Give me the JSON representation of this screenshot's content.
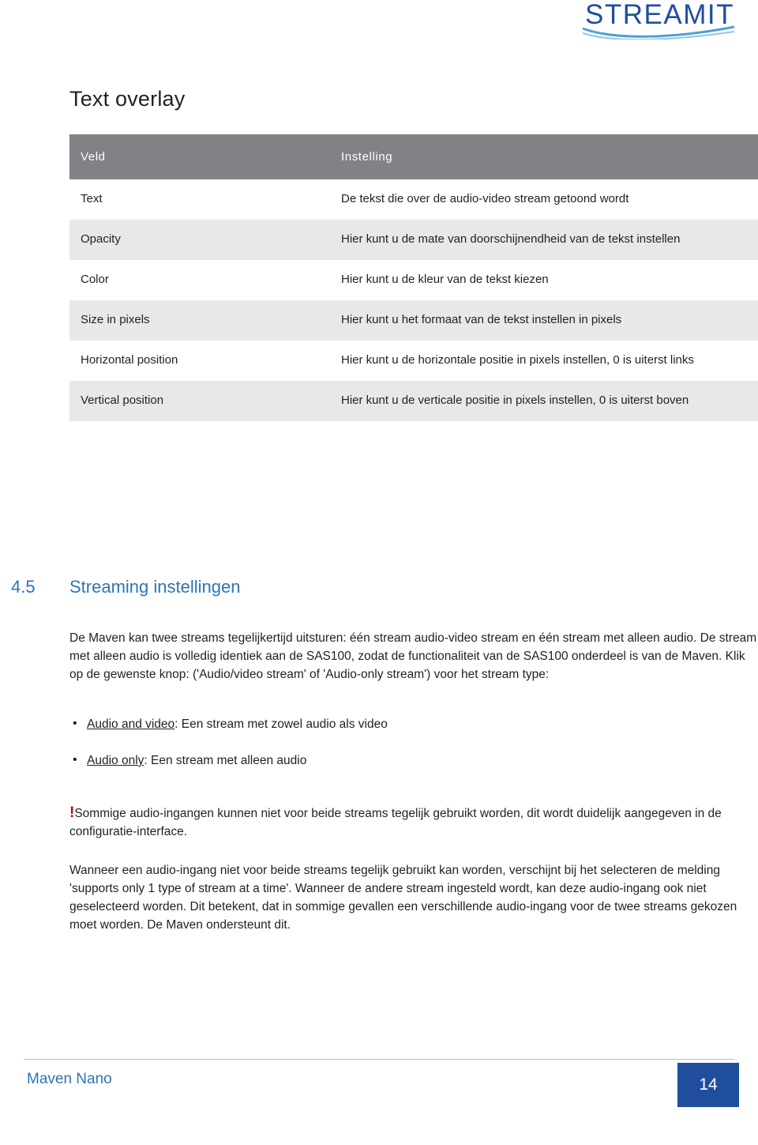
{
  "logo": {
    "text": "STREAMIT",
    "color": "#1f4e9c"
  },
  "page_title": "Text overlay",
  "table": {
    "headers": [
      "Veld",
      "Instelling"
    ],
    "rows": [
      {
        "field": "Text",
        "setting": "De tekst die over de audio-video stream getoond wordt"
      },
      {
        "field": "Opacity",
        "setting": "Hier kunt u de mate van doorschijnendheid van de tekst instellen"
      },
      {
        "field": "Color",
        "setting": "Hier kunt u de kleur van de tekst kiezen"
      },
      {
        "field": "Size in pixels",
        "setting": "Hier kunt u het formaat van de tekst instellen in pixels"
      },
      {
        "field": "Horizontal position",
        "setting": "Hier kunt u de horizontale positie in pixels instellen, 0 is uiterst links"
      },
      {
        "field": "Vertical position",
        "setting": "Hier kunt u de verticale positie in pixels instellen, 0 is uiterst boven"
      }
    ],
    "header_bg": "#808285",
    "row_alt_bg": "#e7e8ea"
  },
  "section": {
    "number": "4.5",
    "title": "Streaming instellingen",
    "color": "#2e74b5"
  },
  "paragraphs": {
    "intro": "De Maven kan twee streams tegelijkertijd uitsturen: één stream audio-video stream en één stream met alleen audio. De stream met alleen audio is volledig identiek aan de SAS100, zodat de functionaliteit van de SAS100 onderdeel is van de Maven. Klik op de gewenste knop: ('Audio/video stream' of 'Audio-only stream') voor het stream type:",
    "bullet1_link": "Audio and video",
    "bullet1_rest": ": Een stream met zowel audio als video",
    "bullet2_link": "Audio only",
    "bullet2_rest": ": Een stream met alleen audio",
    "warning_mark": "!",
    "warning": "Sommige audio-ingangen kunnen niet voor beide streams tegelijk gebruikt worden, dit wordt duidelijk aangegeven in de configuratie-interface.",
    "last": "Wanneer een audio-ingang niet voor beide streams tegelijk gebruikt kan worden, verschijnt bij het selecteren de melding 'supports only 1 type of stream at a time'. Wanneer de andere stream ingesteld wordt, kan deze audio-ingang ook niet geselecteerd worden. Dit betekent, dat in sommige gevallen een verschillende audio-ingang voor de twee streams gekozen moet worden. De Maven ondersteunt dit."
  },
  "footer": {
    "document": "Maven Nano",
    "page": "14",
    "accent": "#1f4e9c"
  }
}
